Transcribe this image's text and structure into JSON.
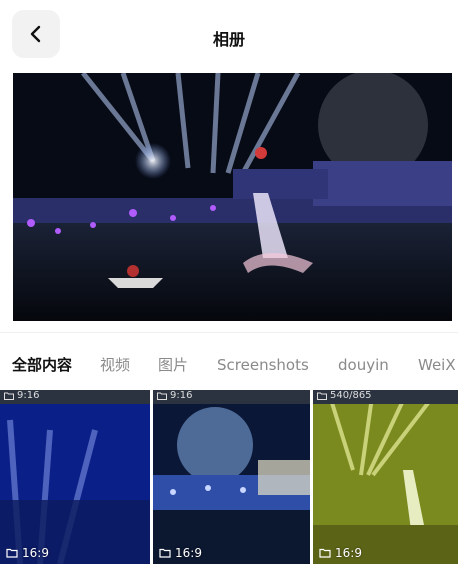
{
  "header": {
    "title": "相册"
  },
  "icons": {
    "back": "chevron-left-icon",
    "folder": "folder-icon"
  },
  "tabs": [
    {
      "label": "全部内容",
      "active": true
    },
    {
      "label": "视频",
      "active": false
    },
    {
      "label": "图片",
      "active": false
    },
    {
      "label": "Screenshots",
      "active": false
    },
    {
      "label": "douyin",
      "active": false
    },
    {
      "label": "WeiX",
      "active": false
    }
  ],
  "grid": [
    {
      "top_label": "9:16",
      "label": "16:9"
    },
    {
      "top_label": "9:16",
      "label": "16:9"
    },
    {
      "top_label": "540/865",
      "label": "16:9"
    }
  ],
  "colors": {
    "accent": "#111111",
    "tab_inactive": "#8a8a8a"
  }
}
